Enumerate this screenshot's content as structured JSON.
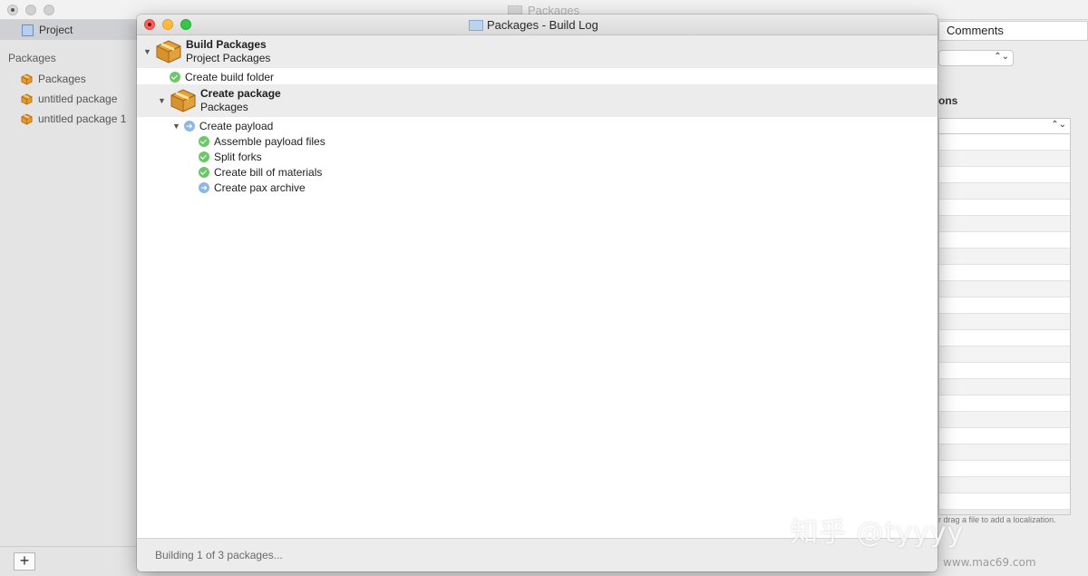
{
  "background_window": {
    "title": "Packages",
    "sidebar": {
      "project_label": "Project",
      "section_label": "Packages",
      "items": [
        "Packages",
        "untitled package",
        "untitled package 1"
      ],
      "add_button": "+"
    },
    "right_panel": {
      "tab_label": "Comments",
      "heading": "ons",
      "hint": "r drag a file to add a localization."
    }
  },
  "log_window": {
    "title": "Packages - Build Log",
    "groups": [
      {
        "title": "Build Packages",
        "subtitle": "Project Packages"
      },
      {
        "title": "Create package",
        "subtitle": "Packages"
      }
    ],
    "steps": {
      "create_build_folder": {
        "label": "Create build folder",
        "status": "done"
      },
      "create_payload": {
        "label": "Create payload",
        "status": "in-progress"
      },
      "assemble_payload_files": {
        "label": "Assemble payload files",
        "status": "done"
      },
      "split_forks": {
        "label": "Split forks",
        "status": "done"
      },
      "create_bill_of_materials": {
        "label": "Create bill of materials",
        "status": "done"
      },
      "create_pax_archive": {
        "label": "Create pax archive",
        "status": "in-progress"
      }
    },
    "status_text": "Building 1 of 3 packages..."
  },
  "watermark": {
    "text": "知乎 @tyyyy",
    "site": "www.mac69.com"
  },
  "colors": {
    "done": "#6cc76a",
    "in_progress": "#8db8e6",
    "close": "#fc605c",
    "minimize": "#fdbc40",
    "zoom": "#34c84a"
  }
}
